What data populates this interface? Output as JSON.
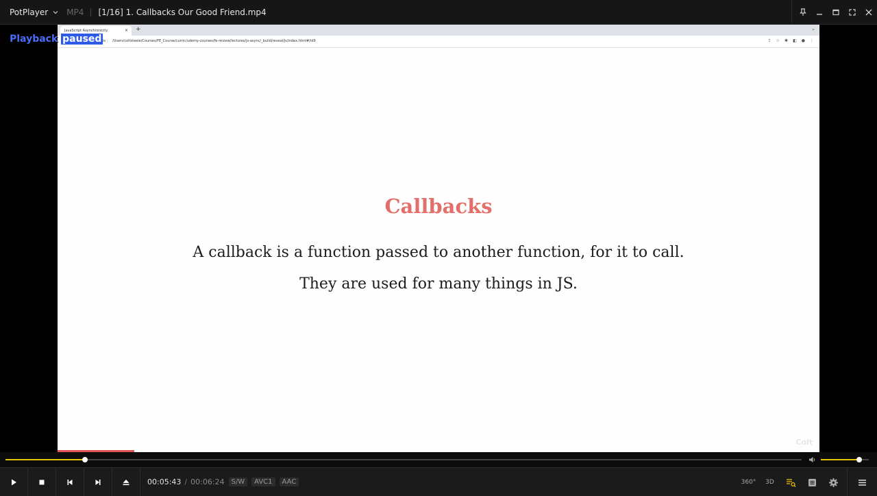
{
  "titlebar": {
    "app_name": "PotPlayer",
    "format": "MP4",
    "title": "[1/16] 1. Callbacks Our Good Friend.mp4"
  },
  "osd": {
    "text_a": "Playback",
    "text_b": "paused"
  },
  "browser": {
    "tab_title": "JavaScript Asynchronicity",
    "tab_close": "×",
    "new_tab": "+",
    "file_label": "File",
    "url": "/Users/coltsteele/Courses/FE_Course/curric/udemy-courses/fe-review/lectures/js-async/_build/reveal/js/index.html#/id9"
  },
  "slide": {
    "title": "Callbacks",
    "line1": "A callback is a function passed to another function, for it to call.",
    "line2": "They are used for many things in JS.",
    "watermark": "Colt"
  },
  "player": {
    "progress": 0.1,
    "volume": 0.8,
    "current_time": "00:05:43",
    "separator": "/",
    "duration": "00:06:24",
    "badges": [
      "S/W",
      "AVC1",
      "AAC"
    ],
    "btn_360": "360°",
    "btn_3d": "3D"
  },
  "colors": {
    "accent": "#e6c400",
    "slide_title": "#e36f6b",
    "osd": "#4a6cf7"
  }
}
